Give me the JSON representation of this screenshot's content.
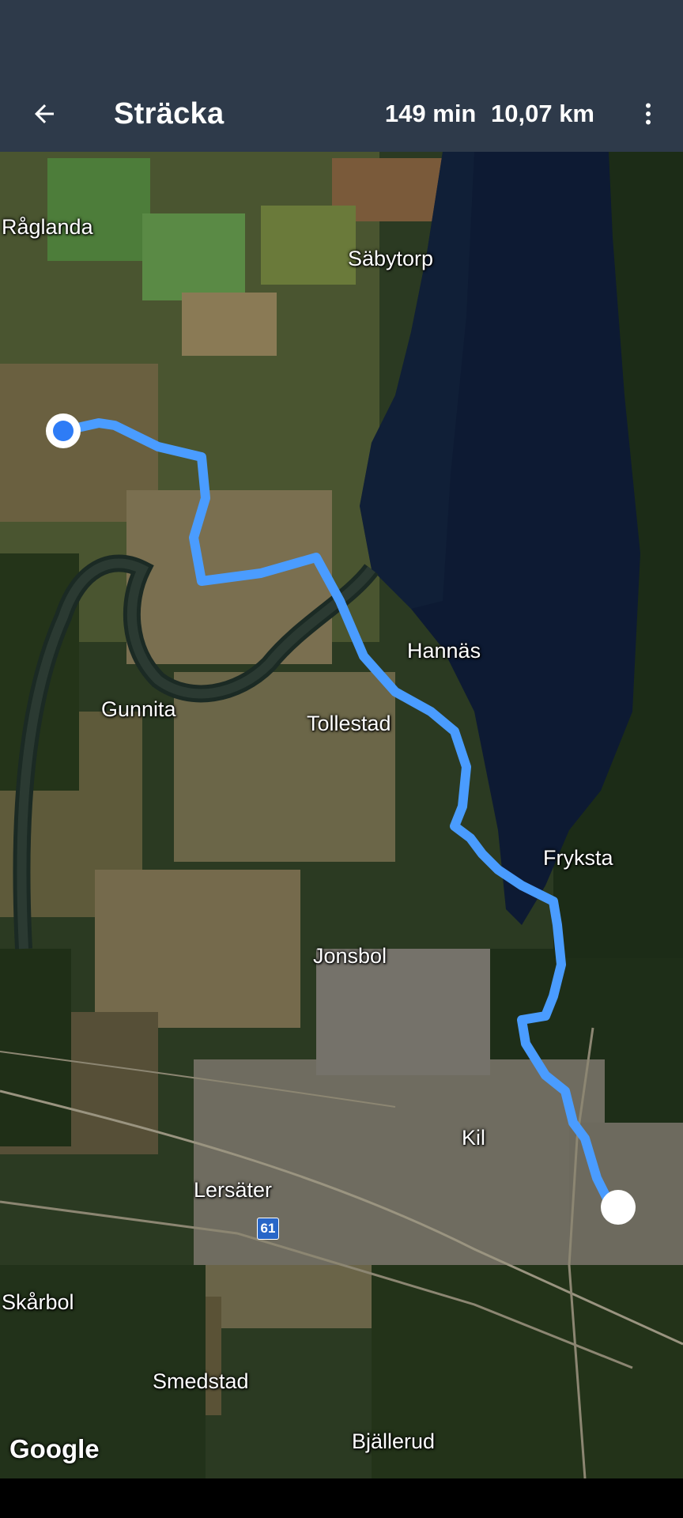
{
  "app_bar": {
    "title": "Sträcka",
    "duration": "149 min",
    "distance": "10,07 km"
  },
  "icons": {
    "back": "arrow-left-icon",
    "more": "more-vert-icon"
  },
  "map": {
    "places": [
      "Råglanda",
      "Säbytorp",
      "Hannäs",
      "Gunnita",
      "Tollestad",
      "Fryksta",
      "Jonsbol",
      "Kil",
      "Lersäter",
      "Skårbol",
      "Smedstad",
      "Bjällerud"
    ],
    "road_number": "61",
    "attribution": "Google",
    "route_color": "#4a9cff"
  }
}
